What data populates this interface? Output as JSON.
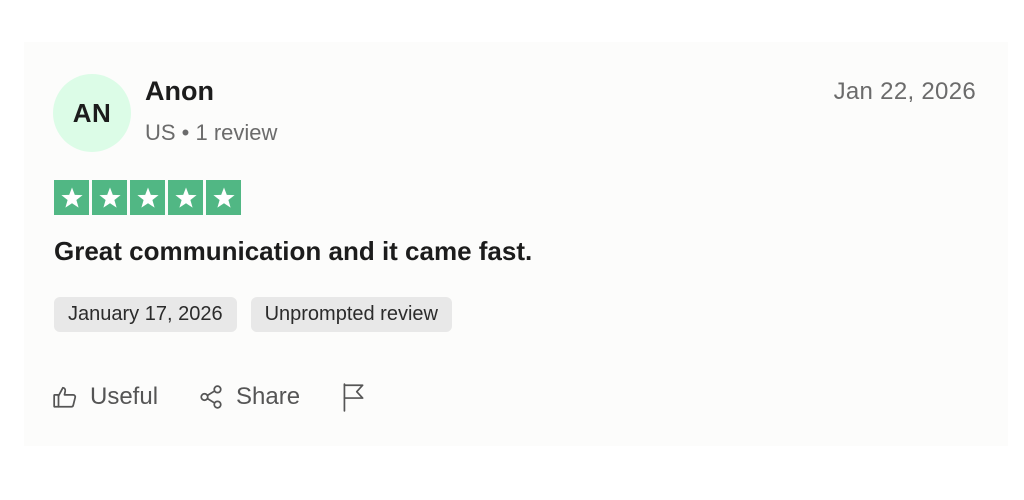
{
  "review": {
    "avatar_initials": "AN",
    "author_name": "Anon",
    "author_meta": "US • 1 review",
    "posted_date": "Jan 22, 2026",
    "rating": 5,
    "rating_max": 5,
    "star_color": "#51b784",
    "avatar_color": "#dcfce7",
    "text": "Great communication and it came fast.",
    "tags": [
      {
        "label": "January 17, 2026"
      },
      {
        "label": "Unprompted review"
      }
    ]
  },
  "actions": {
    "useful_label": "Useful",
    "useful_icon": "thumbs-up-icon",
    "share_label": "Share",
    "share_icon": "share-icon",
    "report_icon": "flag-icon"
  }
}
